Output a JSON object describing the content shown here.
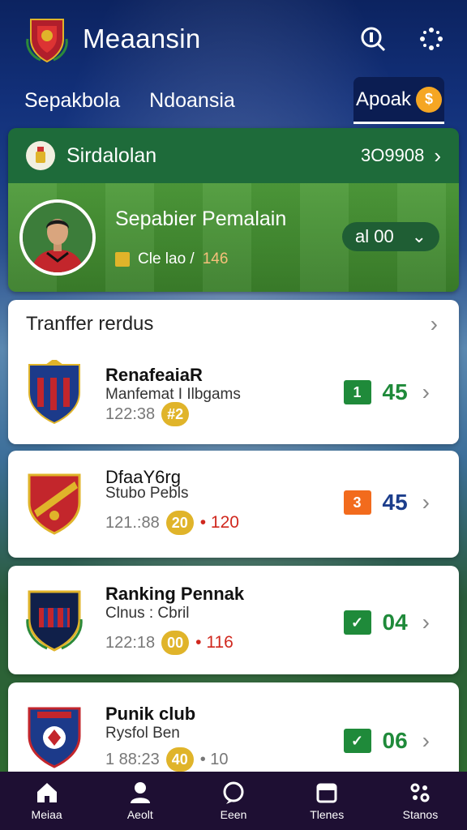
{
  "header": {
    "title": "Meaansin"
  },
  "nav": {
    "tab1": "Sepakbola",
    "tab2": "Ndoansia",
    "pill": "Apoak",
    "pill_coin": "$"
  },
  "featured": {
    "title": "Sirdalolan",
    "code": "3O9908",
    "name": "Sepabier Pemalain",
    "sub_text": "Cle  lao /",
    "sub_highlight": "146",
    "select_value": "al  00"
  },
  "list": {
    "title": "Tranffer rerdus",
    "items": [
      {
        "name": "RenafeaiaR",
        "sub": "Manfemat I Ilbgams",
        "meta": "122:38",
        "pill": "#2",
        "extra": "",
        "box": "1",
        "score": "45"
      },
      {
        "name": "DfaaY6rg",
        "sub": "Stubo Pebls",
        "meta": "121.:88",
        "pill": "20",
        "extra": "• 120",
        "box": "3",
        "score": "45"
      },
      {
        "name": "Ranking Pennak",
        "sub": "Clnus : Cbril",
        "meta": "122:18",
        "pill": "00",
        "extra": "• 116",
        "box": "✓",
        "score": "04"
      },
      {
        "name": "Punik club",
        "sub": "Rysfol Ben",
        "meta": "1 88:23",
        "pill": "40",
        "extra": "• 10",
        "box": "✓",
        "score": "06"
      }
    ]
  },
  "bottom_nav": [
    {
      "label": "Meiaa"
    },
    {
      "label": "Aeolt"
    },
    {
      "label": "Eeen"
    },
    {
      "label": "Tlenes"
    },
    {
      "label": "Stanos"
    }
  ]
}
